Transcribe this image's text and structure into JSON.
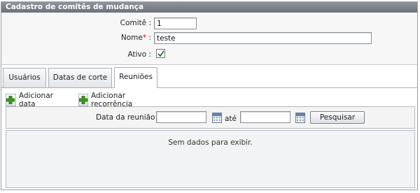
{
  "panel": {
    "title": "Cadastro de comitês de mudança"
  },
  "form": {
    "comite_label": "Comitê :",
    "comite_value": "1",
    "nome_label": "Nome",
    "required_mark": "*",
    "nome_colon": " :",
    "nome_value": "teste",
    "ativo_label": "Ativo :",
    "ativo_checked": true
  },
  "tabs": [
    {
      "label": "Usuários",
      "active": false
    },
    {
      "label": "Datas de corte",
      "active": false
    },
    {
      "label": "Reuniões",
      "active": true
    }
  ],
  "toolbar": {
    "add_date_label": "Adicionar data",
    "add_recurrence_label": "Adicionar recorrência",
    "icon": "plus-icon"
  },
  "filter": {
    "date_label": "Data da reunião :",
    "date_from_value": "",
    "until_label": "até",
    "date_to_value": "",
    "search_label": "Pesquisar",
    "calendar_icon": "calendar-icon"
  },
  "grid": {
    "empty_message": "Sem dados para exibir."
  },
  "colors": {
    "title_bar": "#7d828a",
    "plus_green": "#3a9a1e",
    "required": "#d00000"
  }
}
